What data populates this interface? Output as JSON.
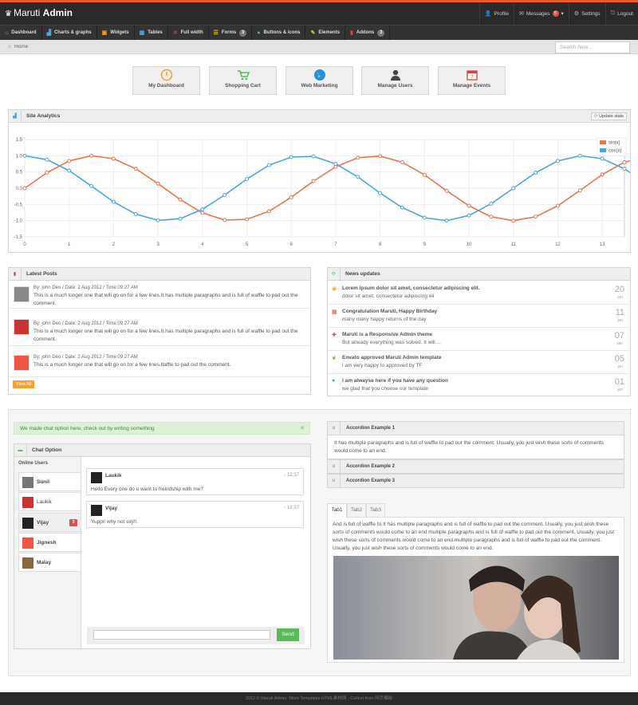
{
  "brand": {
    "light": "Maruti",
    "bold": "Admin"
  },
  "usernav": {
    "profile": "Profile",
    "messages": "Messages",
    "messages_count": "5",
    "settings": "Settings",
    "logout": "Logout"
  },
  "nav": [
    {
      "label": "Dashboard",
      "icon": "home-icon"
    },
    {
      "label": "Charts & graphs",
      "icon": "bar-chart-icon"
    },
    {
      "label": "Widgets",
      "icon": "widget-icon"
    },
    {
      "label": "Tables",
      "icon": "table-icon"
    },
    {
      "label": "Full width",
      "icon": "fullscreen-icon"
    },
    {
      "label": "Forms",
      "icon": "form-icon",
      "badge": "3"
    },
    {
      "label": "Buttons & icons",
      "icon": "tint-icon"
    },
    {
      "label": "Elements",
      "icon": "pencil-icon"
    },
    {
      "label": "Addons",
      "icon": "file-icon",
      "badge": "3"
    }
  ],
  "breadcrumb": "Home",
  "search": {
    "placeholder": "Search here..."
  },
  "quick": [
    "My Dashboard",
    "Shopping Cart",
    "Web Marketing",
    "Manage Users",
    "Manage Events"
  ],
  "analytics": {
    "title": "Site Analytics",
    "update": "Update stats"
  },
  "chart_data": {
    "type": "line",
    "x": [
      0,
      0.5,
      1,
      1.5,
      2,
      2.5,
      3,
      3.5,
      4,
      4.5,
      5,
      5.5,
      6,
      6.5,
      7,
      7.5,
      8,
      8.5,
      9,
      9.5,
      10,
      10.5,
      11,
      11.5,
      12,
      12.5,
      13,
      13.5,
      14
    ],
    "series": [
      {
        "name": "sin(x)",
        "color": "#e8764b",
        "values": [
          0,
          0.48,
          0.84,
          1.0,
          0.91,
          0.6,
          0.14,
          -0.35,
          -0.76,
          -0.98,
          -0.96,
          -0.71,
          -0.28,
          0.22,
          0.66,
          0.94,
          0.99,
          0.8,
          0.41,
          -0.08,
          -0.54,
          -0.88,
          -1.0,
          -0.88,
          -0.54,
          -0.07,
          0.42,
          0.8,
          0.99
        ]
      },
      {
        "name": "cos(x)",
        "color": "#4ca6dc",
        "values": [
          1.0,
          0.88,
          0.54,
          0.07,
          -0.42,
          -0.8,
          -0.99,
          -0.94,
          -0.65,
          -0.21,
          0.28,
          0.71,
          0.96,
          0.98,
          0.75,
          0.35,
          -0.15,
          -0.6,
          -0.91,
          -1.0,
          -0.84,
          -0.48,
          0.0,
          0.48,
          0.84,
          1.0,
          0.91,
          0.6,
          0.14
        ]
      }
    ],
    "yticks": [
      "1.5",
      "1.0",
      "0.5",
      "0.0",
      "-0.5",
      "-1.0",
      "-1.5"
    ],
    "xticks": [
      "0",
      "1",
      "2",
      "3",
      "4",
      "5",
      "6",
      "7",
      "8",
      "9",
      "10",
      "11",
      "12",
      "13"
    ],
    "ylim": [
      -1.5,
      1.5
    ],
    "xlim": [
      0,
      13.5
    ],
    "grid": true,
    "legend": "top-right"
  },
  "posts": {
    "title": "Latest Posts",
    "items": [
      {
        "meta": "By: john Deo / Date: 2 Aug 2012 / Time:09:27 AM",
        "text": "This is a much longer one that will go on for a few lines.It has multiple paragraphs and is full of waffle to pad out the comment."
      },
      {
        "meta": "By: john Deo / Date: 2 Aug 2012 / Time:09:27 AM",
        "text": "This is a much longer one that will go on for a few lines.It has multiple paragraphs and is full of waffle to pad out the comment."
      },
      {
        "meta": "By: john Deo / Date: 2 Aug 2012 / Time:09:27 AM",
        "text": "This is a much longer one that will go on for a few lines.Itaffle to pad out the comment."
      }
    ],
    "view_all": "View All"
  },
  "news": {
    "title": "News updates",
    "items": [
      {
        "title": "Lorem ipsum dolor sit amet, consectetur adipiscing elit.",
        "desc": "dolor sit amet, consectetur adipiscing eli",
        "day": "20",
        "month": "jan",
        "icon": "circle-icon",
        "color": "#f0a030"
      },
      {
        "title": "Congratulation Maruti, Happy Birthday",
        "desc": "many many happy returns of the day",
        "day": "11",
        "month": "jan",
        "icon": "gift-icon",
        "color": "#e04040"
      },
      {
        "title": "Maruti is a Responsive Admin theme",
        "desc": "But already everything was solved. It will ...",
        "day": "07",
        "month": "Jan",
        "icon": "plus-icon",
        "color": "#e04040"
      },
      {
        "title": "Envato approved Maruti Admin template",
        "desc": "i am very happy to approved by TF",
        "day": "05",
        "month": "jan",
        "icon": "leaf-icon",
        "color": "#6ab04c"
      },
      {
        "title": "I am alwayse here if you have any question",
        "desc": "we glad that you choose our template",
        "day": "01",
        "month": "jan",
        "icon": "question-icon",
        "color": "#5cb85c"
      }
    ]
  },
  "alert": "We made chat option here, check out by writing something",
  "chat": {
    "title": "Chat Option",
    "online_title": "Online Users",
    "users": [
      {
        "name": "Sunil"
      },
      {
        "name": "Laukik"
      },
      {
        "name": "Vijay",
        "badge": "3"
      },
      {
        "name": "Jignesh"
      },
      {
        "name": "Malay"
      }
    ],
    "messages": [
      {
        "name": "Laukik",
        "time": "- 12:37",
        "text": "Hello Every one do u want to freindship with me?"
      },
      {
        "name": "Vijay",
        "time": "- 12:37",
        "text": "Yuppi! why not sirji!!."
      }
    ],
    "send": "Send"
  },
  "accordion": {
    "items": [
      "Accordion Example 1",
      "Accordion Example 2",
      "Accordion Example 3"
    ],
    "body": "It has multiple paragraphs and is full of waffle to pad out the comment. Usually, you just wish these sorts of comments would come to an end."
  },
  "tabs": {
    "labels": [
      "Tab1",
      "Tab2",
      "Tab3"
    ],
    "body": "And is full of waffle to It has multiple paragraphs and is full of waffle to pad out the comment. Usually, you just wish these sorts of comments would come to an end multiple paragraphs and is full of waffle to pad out the comment. Usually, you just wish these sorts of comments would come to an end.multiple paragraphs and is full of waffle to pad out the comment. Usually, you just wish these sorts of comments would come to an end."
  },
  "footer": "2012 © Maruti Admin. More Templates HTML素材网 - Collect from 网页模板"
}
